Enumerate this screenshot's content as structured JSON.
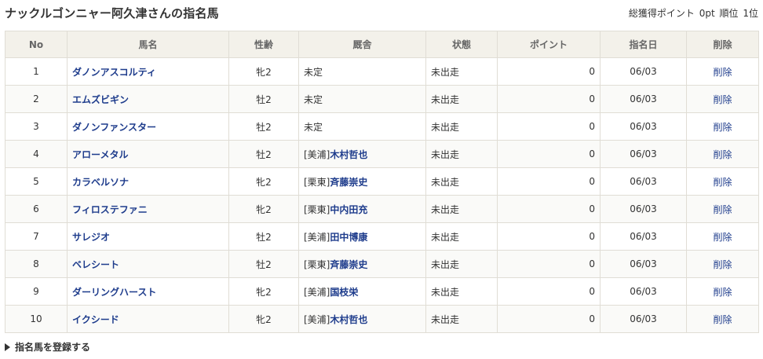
{
  "page": {
    "title": "ナックルゴンニャー阿久津さんの指名馬",
    "summary_label": "総獲得ポイント",
    "summary_points": "0pt",
    "summary_rank_label": "順位",
    "summary_rank": "1位"
  },
  "table": {
    "headers": [
      "No",
      "馬名",
      "性齢",
      "厩舎",
      "状態",
      "ポイント",
      "指名日",
      "削除"
    ],
    "rows": [
      {
        "no": "1",
        "name": "ダノンアスコルティ",
        "sex_age": "牝2",
        "stable_prefix": "未定",
        "stable_name": "",
        "status": "未出走",
        "points": "0",
        "date": "06/03",
        "delete": "削除"
      },
      {
        "no": "2",
        "name": "エムズビギン",
        "sex_age": "牡2",
        "stable_prefix": "未定",
        "stable_name": "",
        "status": "未出走",
        "points": "0",
        "date": "06/03",
        "delete": "削除"
      },
      {
        "no": "3",
        "name": "ダノンファンスター",
        "sex_age": "牡2",
        "stable_prefix": "未定",
        "stable_name": "",
        "status": "未出走",
        "points": "0",
        "date": "06/03",
        "delete": "削除"
      },
      {
        "no": "4",
        "name": "アローメタル",
        "sex_age": "牡2",
        "stable_prefix": "[美浦]",
        "stable_name": "木村哲也",
        "status": "未出走",
        "points": "0",
        "date": "06/03",
        "delete": "削除"
      },
      {
        "no": "5",
        "name": "カラベルソナ",
        "sex_age": "牝2",
        "stable_prefix": "[栗東]",
        "stable_name": "斉藤崇史",
        "status": "未出走",
        "points": "0",
        "date": "06/03",
        "delete": "削除"
      },
      {
        "no": "6",
        "name": "フィロステファニ",
        "sex_age": "牝2",
        "stable_prefix": "[栗東]",
        "stable_name": "中内田充",
        "status": "未出走",
        "points": "0",
        "date": "06/03",
        "delete": "削除"
      },
      {
        "no": "7",
        "name": "サレジオ",
        "sex_age": "牡2",
        "stable_prefix": "[美浦]",
        "stable_name": "田中博康",
        "status": "未出走",
        "points": "0",
        "date": "06/03",
        "delete": "削除"
      },
      {
        "no": "8",
        "name": "ベレシート",
        "sex_age": "牡2",
        "stable_prefix": "[栗東]",
        "stable_name": "斉藤崇史",
        "status": "未出走",
        "points": "0",
        "date": "06/03",
        "delete": "削除"
      },
      {
        "no": "9",
        "name": "ダーリングハースト",
        "sex_age": "牝2",
        "stable_prefix": "[美浦]",
        "stable_name": "国枝栄",
        "status": "未出走",
        "points": "0",
        "date": "06/03",
        "delete": "削除"
      },
      {
        "no": "10",
        "name": "イクシード",
        "sex_age": "牝2",
        "stable_prefix": "[美浦]",
        "stable_name": "木村哲也",
        "status": "未出走",
        "points": "0",
        "date": "06/03",
        "delete": "削除"
      }
    ]
  },
  "footer": {
    "register_label": "指名馬を登録する",
    "register_icon": "triangle-right-icon"
  }
}
